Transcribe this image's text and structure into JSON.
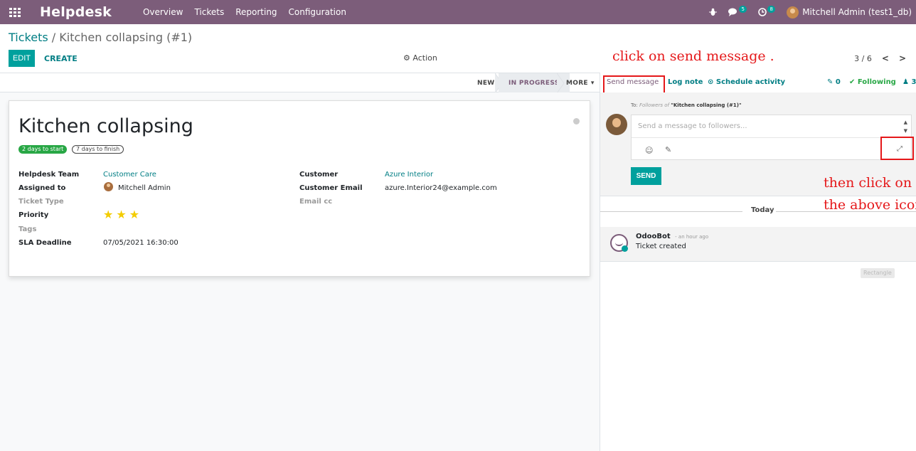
{
  "navbar": {
    "app_name": "Helpdesk",
    "menu": [
      "Overview",
      "Tickets",
      "Reporting",
      "Configuration"
    ],
    "message_count": "5",
    "activity_count": "8",
    "user": "Mitchell Admin (test1_db)"
  },
  "breadcrumb": {
    "parent": "Tickets",
    "separator": "/",
    "current": "Kitchen collapsing (#1)"
  },
  "control": {
    "edit": "EDIT",
    "create": "CREATE",
    "action": "Action",
    "pager": "3 / 6",
    "prev": "<",
    "next": ">"
  },
  "statusbar": {
    "stages": [
      "NEW",
      "IN PROGRESS"
    ],
    "more": "MORE"
  },
  "ticket": {
    "title": "Kitchen collapsing",
    "sla_start": "2 days to start",
    "sla_finish": "7 days to finish",
    "labels": {
      "team": "Helpdesk Team",
      "assigned": "Assigned to",
      "type": "Ticket Type",
      "priority": "Priority",
      "tags": "Tags",
      "sla_deadline": "SLA Deadline",
      "customer": "Customer",
      "customer_email": "Customer Email",
      "email_cc": "Email cc"
    },
    "values": {
      "team": "Customer Care",
      "assigned": "Mitchell Admin",
      "priority_stars": 3,
      "sla_deadline": "07/05/2021 16:30:00",
      "customer": "Azure Interior",
      "customer_email": "azure.Interior24@example.com"
    }
  },
  "chatter": {
    "send_message": "Send message",
    "log_note": "Log note",
    "schedule_activity": "Schedule activity",
    "attachments": "0",
    "following": "Following",
    "followers": "3",
    "to_prefix": "To:",
    "to_followers": "Followers of",
    "to_record": "\"Kitchen collapsing (#1)\"",
    "placeholder": "Send a message to followers...",
    "send_button": "SEND",
    "today": "Today",
    "message": {
      "author": "OdooBot",
      "time": "- an hour ago",
      "body": "Ticket created"
    },
    "rect_tag": "Rectangle"
  },
  "annotations": {
    "step1": "click on send message .",
    "step2_line1": "then click on",
    "step2_line2": "the above icon"
  },
  "colors": {
    "brand": "#7c5d7a",
    "primary": "#00a09d",
    "link": "#017e84",
    "highlight": "#e5181a",
    "star": "#f3cc00"
  }
}
